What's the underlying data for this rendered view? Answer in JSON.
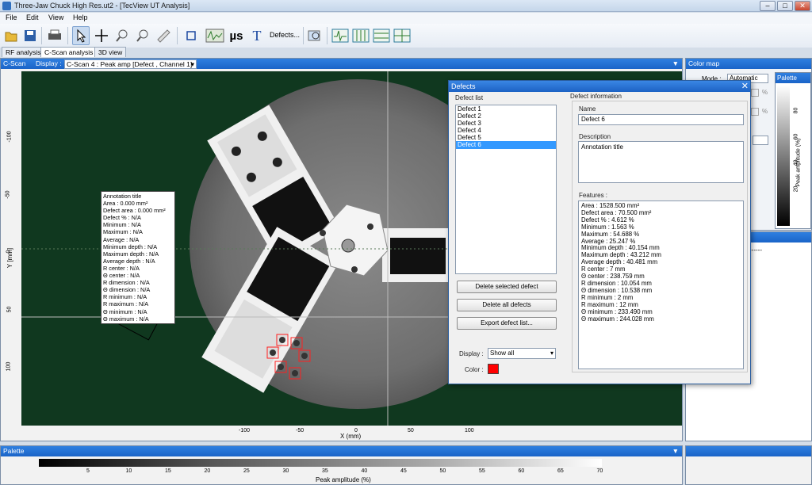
{
  "window": {
    "title": "Three-Jaw Chuck High Res.ut2 - [TecView UT Analysis]",
    "min": "–",
    "max": "□",
    "close": "✕"
  },
  "menu": [
    "File",
    "Edit",
    "View",
    "Help"
  ],
  "toolbar": {
    "defects_label": "Defects...",
    "us_label": "µs",
    "text_label": "T"
  },
  "tabs": [
    "RF analysis",
    "C-Scan analysis",
    "3D view"
  ],
  "cscan": {
    "header": "C-Scan",
    "display_label": "Display :",
    "display_value": "C-Scan 4 : Peak amp [Defect , Channel 1]",
    "y_ticks": [
      "-100",
      "-50",
      "0",
      "50",
      "100"
    ],
    "x_ticks": [
      "-100",
      "-50",
      "0",
      "50",
      "100"
    ],
    "x_label": "X (mm)",
    "y_label": "Y [mm]"
  },
  "annotation": [
    "Annotation title",
    "Area : 0.000 mm²",
    "Defect area : 0.000 mm²",
    "Defect % : N/A",
    "Minimum : N/A",
    "Maximum : N/A",
    "Average : N/A",
    "Minimum depth : N/A",
    "Maximum depth : N/A",
    "Average depth : N/A",
    "R center : N/A",
    "Θ center : N/A",
    "R dimension : N/A",
    "Θ dimension : N/A",
    "R minimum : N/A",
    "R maximum : N/A",
    "Θ minimum : N/A",
    "Θ maximum : N/A"
  ],
  "palette": {
    "header": "Palette",
    "ticks": [
      "5",
      "10",
      "15",
      "20",
      "25",
      "30",
      "35",
      "40",
      "45",
      "50",
      "55",
      "60",
      "65",
      "70"
    ],
    "label": "Peak amplitude (%)"
  },
  "colormap": {
    "header": "Color map",
    "mode_label": "Mode :",
    "mode_value": "Automatic",
    "palette_tab": "Palette",
    "ticks": [
      "80",
      "60",
      "40",
      "20"
    ],
    "axis_label": "Peak amplitude (%)",
    "dash": "------",
    "pct": "%"
  },
  "defects": {
    "title": "Defects",
    "list_label": "Defect list",
    "items": [
      "Defect 1",
      "Defect 2",
      "Defect 3",
      "Defect 4",
      "Defect 5",
      "Defect 6"
    ],
    "selected_index": 5,
    "delete_selected": "Delete selected defect",
    "delete_all": "Delete all defects",
    "export": "Export defect list...",
    "display_label": "Display :",
    "display_value": "Show all",
    "color_label": "Color :",
    "color": "#ff0000",
    "info_label": "Defect information",
    "name_label": "Name",
    "name_value": "Defect 6",
    "desc_label": "Description",
    "desc_value": "Annotation title",
    "features_label": "Features :",
    "features": [
      "Area : 1528.500 mm²",
      "Defect area : 70.500 mm²",
      "Defect % : 4.612 %",
      "Minimum : 1.563 %",
      "Maximum : 54.688 %",
      "Average : 25.247 %",
      "Minimum depth : 40.154 mm",
      "Maximum depth : 43.212 mm",
      "Average depth : 40.481 mm",
      "R center : 7 mm",
      "Θ center : 238.759 mm",
      "R dimension : 10.054 mm",
      "Θ dimension : 10.538 mm",
      "R minimum : 2 mm",
      "R maximum : 12 mm",
      "Θ minimum : 233.490 mm",
      "Θ maximum : 244.028 mm"
    ]
  }
}
